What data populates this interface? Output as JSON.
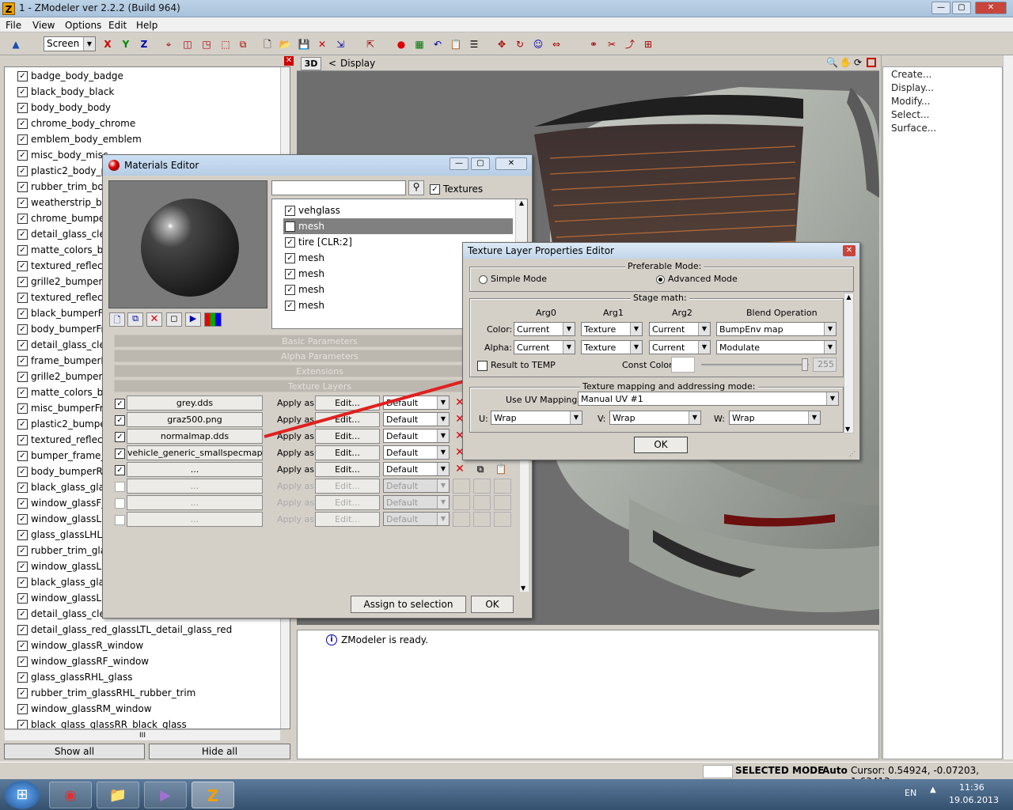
{
  "window": {
    "title": "1 - ZModeler ver 2.2.2 (Build 964)",
    "icon": "Z",
    "min": "—",
    "max": "▢",
    "close": "✕"
  },
  "menu": [
    "File",
    "View",
    "Options",
    "Edit",
    "Help"
  ],
  "toolbar": {
    "view_select": "Screen",
    "axis_x": "X",
    "axis_y": "Y",
    "axis_z": "Z"
  },
  "left": {
    "items": [
      "badge_body_badge",
      "black_body_black",
      "body_body_body",
      "chrome_body_chrome",
      "emblem_body_emblem",
      "misc_body_misc",
      "plastic2_body_pl",
      "rubber_trim_bod",
      "weatherstrip_boc",
      "chrome_bumper",
      "detail_glass_clear",
      "matte_colors_bu",
      "textured_reflecto",
      "grille2_bumperFB",
      "textured_reflecto",
      "black_bumperFra",
      "body_bumperFra",
      "detail_glass_clear",
      "frame_bumperFr",
      "grille2_bumperFr",
      "matte_colors_bu",
      "misc_bumperFra",
      "plastic2_bumper",
      "textured_reflecto",
      "bumper_frame_b",
      "body_bumperRa",
      "black_glass_glass",
      "window_glassF_v",
      "window_glassLF_",
      "glass_glassLHL_g",
      "rubber_trim_glas",
      "window_glassLM",
      "black_glass_glass",
      "window_glassLR_",
      "detail_glass_clear",
      "detail_glass_red_glassLTL_detail_glass_red",
      "window_glassR_window",
      "window_glassRF_window",
      "glass_glassRHL_glass",
      "rubber_trim_glassRHL_rubber_trim",
      "window_glassRM_window",
      "black_glass_glassRR_black_glass"
    ],
    "show_all": "Show all",
    "hide_all": "Hide all",
    "scroll_mark": "III"
  },
  "viewport": {
    "mode": "3D",
    "nav": "<",
    "label": "Display"
  },
  "right": {
    "items": [
      "Create...",
      "Display...",
      "Modify...",
      "Select...",
      "Surface..."
    ]
  },
  "log": {
    "message": "ZModeler is ready."
  },
  "status": {
    "mode": "SELECTED MODE",
    "auto": "Auto",
    "cursor": "Cursor: 0.54924, -0.07203, 1.63413"
  },
  "taskbar": {
    "lang": "EN",
    "time": "11:36",
    "date": "19.06.2013"
  },
  "materials": {
    "title": "Materials Editor",
    "textures_label": "Textures",
    "list": [
      "vehglass",
      "mesh",
      "tire [CLR:2]",
      "mesh",
      "mesh",
      "mesh",
      "mesh"
    ],
    "sections": [
      "Basic Parameters",
      "Alpha Parameters",
      "Extensions",
      "Texture Layers"
    ],
    "layers": [
      {
        "file": "grey.dds",
        "apply": "Apply as:",
        "edit": "Edit...",
        "mode": "Default",
        "on": true
      },
      {
        "file": "graz500.png",
        "apply": "Apply as:",
        "edit": "Edit...",
        "mode": "Default",
        "on": true
      },
      {
        "file": "normalmap.dds",
        "apply": "Apply as:",
        "edit": "Edit...",
        "mode": "Default",
        "on": true
      },
      {
        "file": "vehicle_generic_smallspecmap.png",
        "apply": "Apply as:",
        "edit": "Edit...",
        "mode": "Default",
        "on": true
      },
      {
        "file": "...",
        "apply": "Apply as:",
        "edit": "Edit...",
        "mode": "Default",
        "on": true
      },
      {
        "file": "...",
        "apply": "Apply as:",
        "edit": "Edit...",
        "mode": "Default",
        "on": false
      },
      {
        "file": "...",
        "apply": "Apply as:",
        "edit": "Edit...",
        "mode": "Default",
        "on": false
      },
      {
        "file": "...",
        "apply": "Apply as:",
        "edit": "Edit...",
        "mode": "Default",
        "on": false
      }
    ],
    "assign": "Assign to selection",
    "ok": "OK"
  },
  "tlpe": {
    "title": "Texture Layer Properties Editor",
    "pref_mode": "Preferable Mode:",
    "simple": "Simple Mode",
    "advanced": "Advanced Mode",
    "stage_math": "Stage math:",
    "headers": [
      "Arg0",
      "Arg1",
      "Arg2",
      "Blend Operation"
    ],
    "color_label": "Color:",
    "alpha_label": "Alpha:",
    "color_vals": [
      "Current",
      "Texture",
      "Current",
      "BumpEnv map"
    ],
    "alpha_vals": [
      "Current",
      "Texture",
      "Current",
      "Modulate"
    ],
    "result_temp": "Result to TEMP",
    "const_color": "Const Color:",
    "const_val": "255",
    "mapping_title": "Texture mapping and addressing mode:",
    "use_uv": "Use UV Mapping:",
    "uv_val": "Manual UV #1",
    "u_label": "U:",
    "v_label": "V:",
    "w_label": "W:",
    "u_val": "Wrap",
    "v_val": "Wrap",
    "w_val": "Wrap",
    "ok": "OK"
  }
}
